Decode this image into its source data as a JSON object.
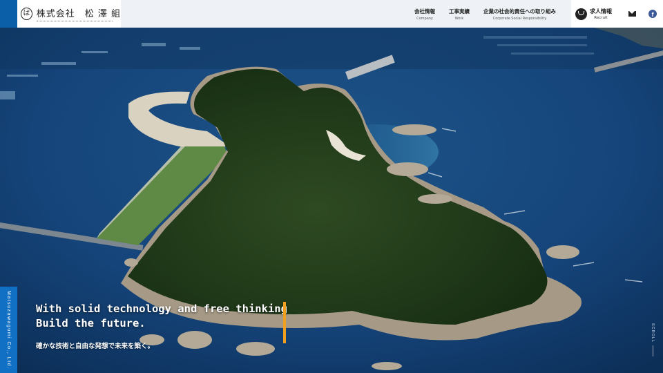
{
  "header": {
    "logo": {
      "mark": "は",
      "name": "株式会社　松 澤 組"
    },
    "nav": [
      {
        "jp": "会社情報",
        "en": "Company"
      },
      {
        "jp": "工事実績",
        "en": "Work"
      },
      {
        "jp": "企業の社会的責任への取り組み",
        "en": "Corporate Social Responsibility"
      }
    ],
    "recruit": {
      "jp": "求人情報",
      "en": "Recruit"
    },
    "mail_icon": "mail-icon",
    "facebook": {
      "glyph": "f",
      "color": "#3b5998"
    }
  },
  "side_tab": {
    "text": "Matsuzawagumi Co., Ltd.",
    "color": "#1170c4"
  },
  "hero": {
    "tagline_en": "With solid technology and free thinking\nBuild the future.",
    "tagline_jp": "確かな技術と自由な発想で未来を築く。",
    "accent_color": "#f0a020"
  },
  "scroll": {
    "label": "SCROLL"
  }
}
